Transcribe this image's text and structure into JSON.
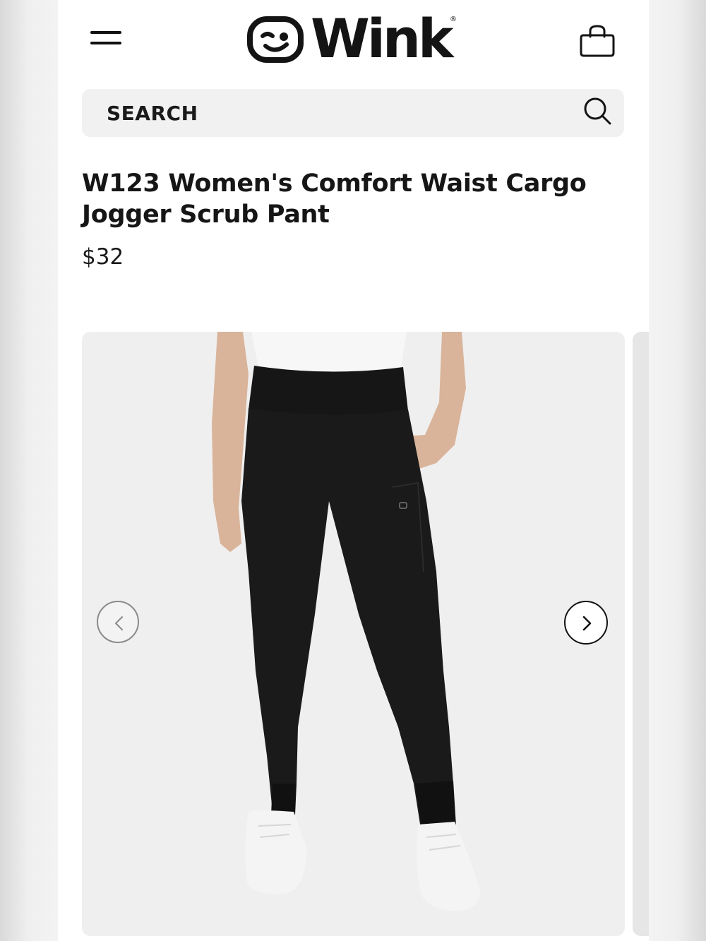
{
  "header": {
    "menu_icon": "hamburger-menu-icon",
    "logo_text": "Wink",
    "logo_registered": "®",
    "bag_icon": "shopping-bag-icon"
  },
  "search": {
    "placeholder": "SEARCH",
    "icon": "search-icon"
  },
  "product": {
    "title": "W123 Women's Comfort Waist Cargo Jogger Scrub Pant",
    "price": "$32",
    "color": "#141414"
  },
  "gallery": {
    "prev_icon": "chevron-left-icon",
    "next_icon": "chevron-right-icon"
  }
}
